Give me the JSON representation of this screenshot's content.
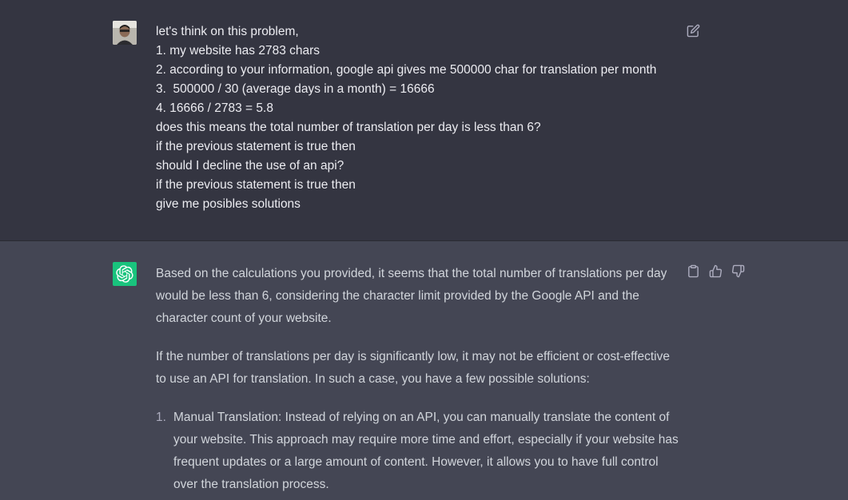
{
  "user_message": {
    "lines": [
      "let's think on this problem,",
      "1. my website has 2783 chars",
      "2. according to your information, google api gives me 500000 char for translation per month",
      "3.  500000 / 30 (average days in a month) = 16666",
      "4. 16666 / 2783 = 5.8",
      "does this means the total number of translation per day is less than 6?",
      "if the previous statement is true then",
      "should I decline the use of an api?",
      "if the previous statement is true then",
      "give me posibles solutions"
    ],
    "edit_icon": "edit-icon"
  },
  "assistant_message": {
    "paragraphs": [
      "Based on the calculations you provided, it seems that the total number of translations per day would be less than 6, considering the character limit provided by the Google API and the character count of your website.",
      "If the number of translations per day is significantly low, it may not be efficient or cost-effective to use an API for translation. In such a case, you have a few possible solutions:"
    ],
    "list": [
      {
        "num": "1.",
        "text": "Manual Translation: Instead of relying on an API, you can manually translate the content of your website. This approach may require more time and effort, especially if your website has frequent updates or a large amount of content. However, it allows you to have full control over the translation process."
      }
    ],
    "action_icons": [
      "clipboard-icon",
      "thumbs-up-icon",
      "thumbs-down-icon"
    ]
  },
  "colors": {
    "user_bg": "#343541",
    "assistant_bg": "#444654",
    "bot_avatar": "#19c37d"
  }
}
